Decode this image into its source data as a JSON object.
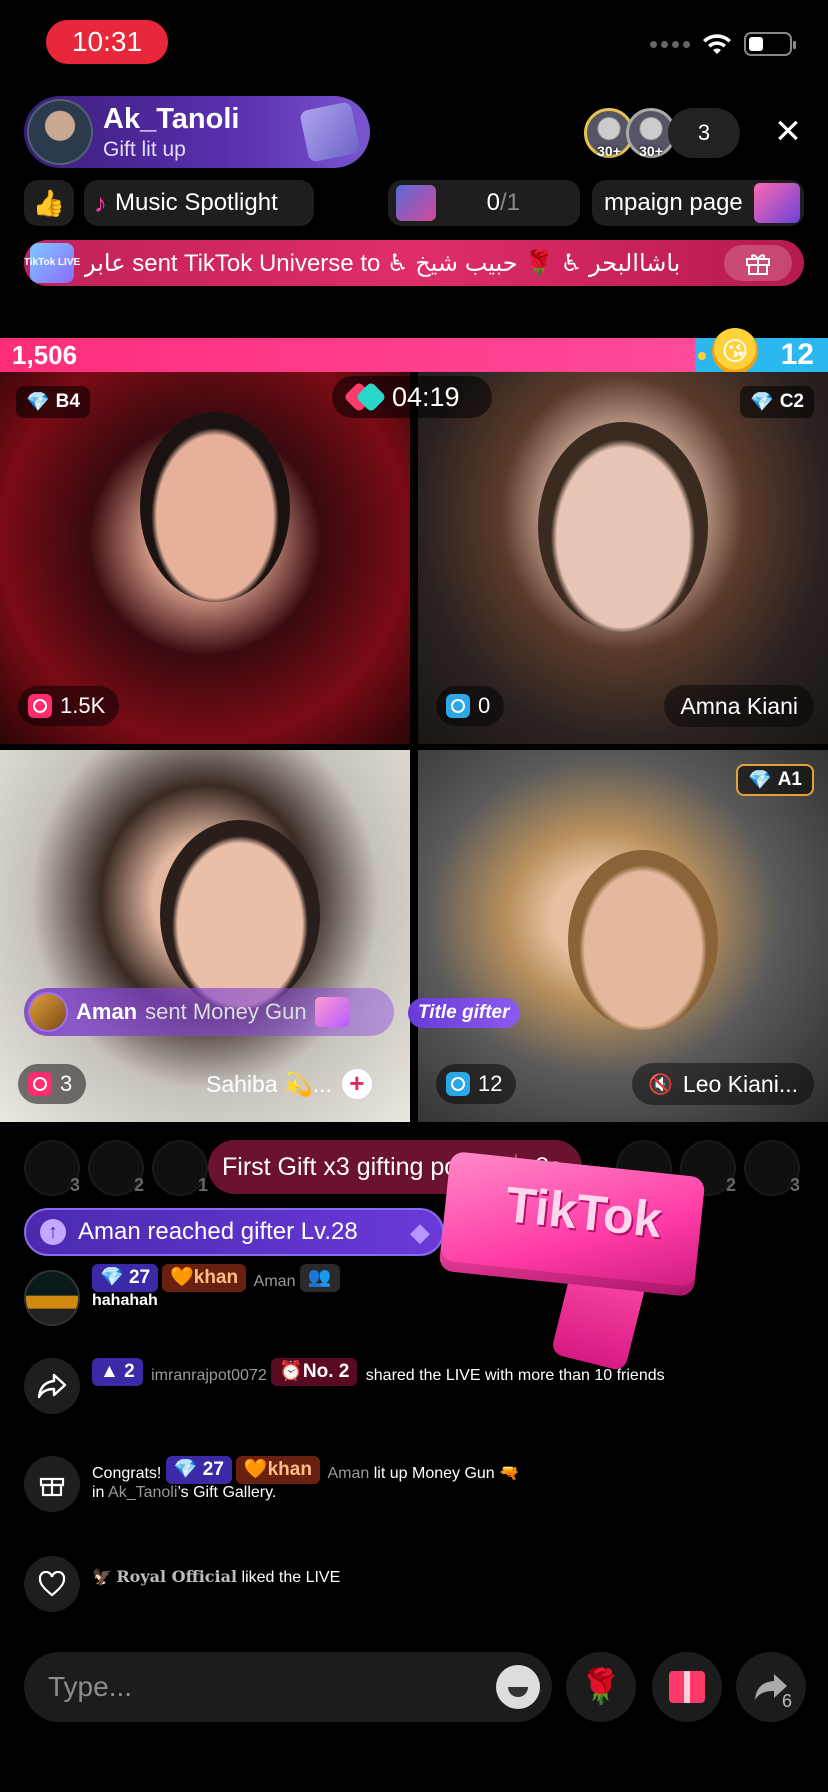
{
  "status_bar": {
    "time": "10:31"
  },
  "host": {
    "name": "Ak_Tanoli",
    "subtitle": "Gift lit up"
  },
  "viewers": {
    "avatar_badges": [
      "30+",
      "30+"
    ],
    "count": "3"
  },
  "close_icon": "×",
  "chips": {
    "fire": "👍",
    "music_label": "Music Spotlight",
    "counter_value": "0",
    "counter_total": "/1",
    "campaign_label": "mpaign page"
  },
  "gift_banner": {
    "icon_text": "TikTok LIVE",
    "text": "عابر sent TikTok Universe to ♿ باشاالبحر ♿ 🌹 حبیب شیخ"
  },
  "battle": {
    "left_score": "1,506",
    "right_score": "12",
    "timer": "04:19"
  },
  "tiles": [
    {
      "rank": "B4",
      "rank_gem": "💎",
      "stat": "1.5K",
      "name": ""
    },
    {
      "rank": "C2",
      "rank_gem": "💎",
      "stat": "0",
      "name": "Amna Kiani"
    },
    {
      "rank": "",
      "stat": "3",
      "name": "Sahiba 💫..."
    },
    {
      "rank": "A1",
      "rank_gem": "💎",
      "stat": "12",
      "name": "Leo Kiani..."
    }
  ],
  "notices": {
    "gun_user": "Aman",
    "gun_text": "sent Money Gun",
    "title_gifter": "Title gifter",
    "first_gift": "First Gift x3 gifting points",
    "first_gift_time": "8s",
    "level_up": "Aman reached gifter Lv.28"
  },
  "avatar_row": [
    "3",
    "2",
    "1",
    "1",
    "2",
    "3"
  ],
  "gun_overlay_text": "TikTok",
  "chat": [
    {
      "level": "27",
      "fan_badge": "khan",
      "user": "Aman",
      "message": "hahahah"
    },
    {
      "level": "2",
      "user": "imranrajpot0072",
      "rank_badge": "No. 2",
      "message": "shared the LIVE with more than 10 friends"
    },
    {
      "prefix": "Congrats!",
      "level": "27",
      "fan_badge": "khan",
      "user": "Aman",
      "message": "lit up Money Gun",
      "suffix_in": "in",
      "host": "Ak_Tanoli",
      "suffix": "’s Gift Gallery."
    },
    {
      "user": "Royal Official",
      "message": "liked the LIVE"
    }
  ],
  "input": {
    "placeholder": "Type..."
  },
  "share_count": "6"
}
